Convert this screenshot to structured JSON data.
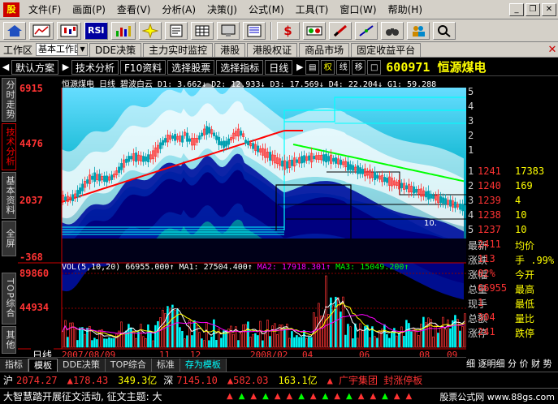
{
  "menubar": {
    "items": [
      "文件(F)",
      "画面(P)",
      "查看(V)",
      "分析(A)",
      "决策(J)",
      "公式(M)",
      "工具(T)",
      "窗口(W)",
      "帮助(H)"
    ],
    "app_icon": "股"
  },
  "toolbar": {
    "rsi_label": "RSI",
    "dollar_label": "$"
  },
  "tabbar": {
    "label": "工作区",
    "workspace": "基本工作区",
    "tabs": [
      "DDE决策",
      "主力实时监控",
      "港股",
      "港股权证",
      "商品市场",
      "固定收益平台"
    ]
  },
  "charttb": {
    "buttons": [
      "默认方案",
      "技术分析",
      "F10资料",
      "选择股票",
      "选择指标",
      "日线"
    ],
    "icons": [
      "权",
      "线",
      "移"
    ],
    "stock_code": "600971",
    "stock_name": "恒源煤电"
  },
  "sidetabs": [
    "分时走势",
    "技术分析",
    "基本资料",
    "全屏",
    "TOP综合",
    "其他"
  ],
  "main": {
    "ma_legend": [
      {
        "text": "恒源煤电 日线  碧波白云",
        "color": "#ffffff"
      },
      {
        "text": "D1: 3.662↓",
        "color": "#ffffff"
      },
      {
        "text": "D2: 12.933↓",
        "color": "#ffffff"
      },
      {
        "text": "D3: 17.569↓",
        "color": "#ffffff"
      },
      {
        "text": "D4: 22.204↓",
        "color": "#ffffff"
      },
      {
        "text": "G1: 59.288",
        "color": "#ffffff"
      }
    ],
    "vol_legend": [
      {
        "text": "VOL(5,10,20) 66955.000↑",
        "color": "#ffffff"
      },
      {
        "text": "MA1: 27504.400↑",
        "color": "#ffffff"
      },
      {
        "text": "MA2: 17918.301↑",
        "color": "#ff00ff"
      },
      {
        "text": "MA3: 15049.200↑",
        "color": "#00ff00"
      }
    ],
    "price_ticks": [
      "6915",
      "4476",
      "2037",
      "-368"
    ],
    "vol_ticks": [
      "89860",
      "44934"
    ],
    "annotation": "10.",
    "period_label": "日线",
    "dates": [
      "2007/08/09",
      "11",
      "12",
      "2008/02",
      "04",
      "06",
      "08",
      "09"
    ]
  },
  "right_panel": {
    "rows": [
      {
        "c1": "5",
        "c2": "",
        "c3": ""
      },
      {
        "c1": "4",
        "c2": "",
        "c3": ""
      },
      {
        "c1": "3",
        "c2": "",
        "c3": ""
      },
      {
        "c1": "2",
        "c2": "",
        "c3": ""
      },
      {
        "c1": "1",
        "c2": "",
        "c3": ""
      },
      {
        "c1": "1",
        "c2": "1241",
        "c3": "17383"
      },
      {
        "c1": "2",
        "c2": "1240",
        "c3": "169"
      },
      {
        "c1": "3",
        "c2": "1239",
        "c3": "4"
      },
      {
        "c1": "4",
        "c2": "1238",
        "c3": "10"
      },
      {
        "c1": "5",
        "c2": "1237",
        "c3": "10"
      },
      {
        "c1": "最新",
        "c2": "2411",
        "c3": "均价"
      },
      {
        "c1": "涨跌",
        "c2": "113",
        "c3": "手 .99%"
      },
      {
        "c1": "涨幅",
        "c2": "02%",
        "c3": "今开"
      },
      {
        "c1": "总量",
        "c2": "66955",
        "c3": "最高"
      },
      {
        "c1": "现手",
        "c2": "1",
        "c3": "最低"
      },
      {
        "c1": "总额",
        "c2": "304",
        "c3": "量比"
      },
      {
        "c1": "涨停",
        "c2": "241",
        "c3": "跌停"
      }
    ],
    "bottom_label": "细 逐明细 分 价 财 势"
  },
  "bottomtabs": [
    "指标",
    "模板",
    "DDE决策",
    "TOP综合",
    "标准",
    "存为模板"
  ],
  "idxbar": {
    "sh_label": "沪",
    "sh_value": "2074.27",
    "sh_change": "▲178.43",
    "sh_vol": "349.3亿",
    "sz_label": "深",
    "sz_value": "7145.10",
    "sz_change": "▲582.03",
    "sz_vol": "163.1亿",
    "news": "▲ 广宇集团 封涨停板"
  },
  "newsbar": {
    "ticker": "大智慧踏开展征文活动, 征文主题: 大",
    "site": "股票公式网 www.88gs.com"
  },
  "colors": {
    "up": "#ff3333",
    "down": "#00ffff",
    "accent": "#ffff00",
    "ma_red": "#ff0000",
    "ma_green": "#00ff00",
    "band_dark": "#0000a0"
  }
}
